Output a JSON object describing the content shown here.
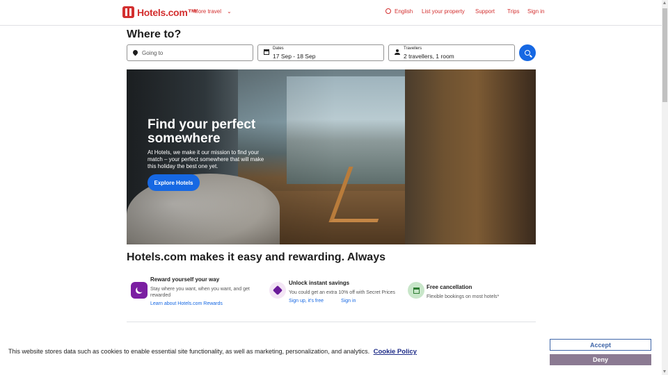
{
  "header": {
    "logo_text": "Hotels.com™",
    "more_travel": "More travel",
    "language": "English",
    "list_property": "List your property",
    "support": "Support",
    "trips": "Trips",
    "sign_in": "Sign in"
  },
  "search": {
    "title": "Where to?",
    "destination_placeholder": "Going to",
    "dates_label": "Dates",
    "dates_value": "17 Sep - 18 Sep",
    "travellers_label": "Travellers",
    "travellers_value": "2 travellers, 1 room"
  },
  "hero": {
    "title": "Find your perfect somewhere",
    "text": "At Hotels, we make it our mission to find your match – your perfect somewhere that will make this holiday the best one yet.",
    "button": "Explore Hotels"
  },
  "rewards": {
    "title": "Hotels.com makes it easy and rewarding. Always",
    "features": [
      {
        "title": "Reward yourself your way",
        "text": "Stay where you want, when you want, and get rewarded",
        "link": "Learn about Hotels.com Rewards",
        "icon": "moon-icon",
        "color": "#7b1fa2"
      },
      {
        "title": "Unlock instant savings",
        "text": "You could get an extra 10% off with Secret Prices",
        "link": "Sign up, it's free",
        "link2": "Sign in",
        "icon": "tag-icon",
        "color": "#6a1b9a"
      },
      {
        "title": "Free cancellation",
        "text": "Flexible bookings on most hotels*",
        "icon": "calendar-check-icon",
        "color": "#2e7d32"
      }
    ]
  },
  "cookie": {
    "text": "This website stores data such as cookies to enable essential site functionality, as well as marketing, personalization, and analytics.",
    "policy_link": "Cookie Policy",
    "accept": "Accept",
    "deny": "Deny"
  },
  "colors": {
    "brand": "#d32f2f",
    "accent": "#1668e3"
  }
}
